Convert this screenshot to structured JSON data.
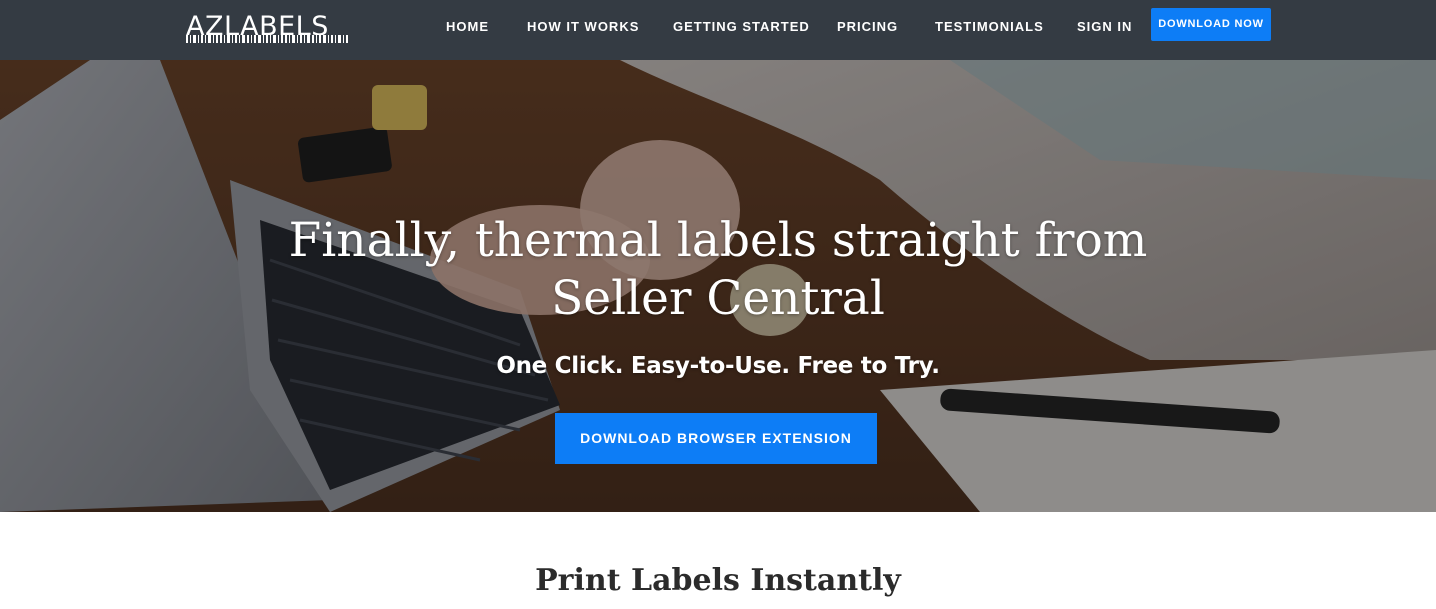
{
  "brand": {
    "logo_text": "AZLABELS",
    "logo_icon": "barcode-icon"
  },
  "nav": {
    "items": [
      {
        "label": "HOME"
      },
      {
        "label": "HOW IT WORKS"
      },
      {
        "label": "GETTING STARTED"
      },
      {
        "label": "PRICING"
      },
      {
        "label": "TESTIMONIALS"
      },
      {
        "label": "SIGN IN"
      }
    ],
    "download_label": "DOWNLOAD NOW"
  },
  "hero": {
    "title_line1": "Finally, thermal labels straight from",
    "title_line2": "Seller Central",
    "subtitle": "One Click. Easy-to-Use. Free to Try.",
    "cta_label": "DOWNLOAD BROWSER EXTENSION"
  },
  "section": {
    "title": "Print Labels Instantly"
  },
  "colors": {
    "navbar": "#343b43",
    "accent": "#0d7df6",
    "text_dark": "#2b2b2b"
  }
}
